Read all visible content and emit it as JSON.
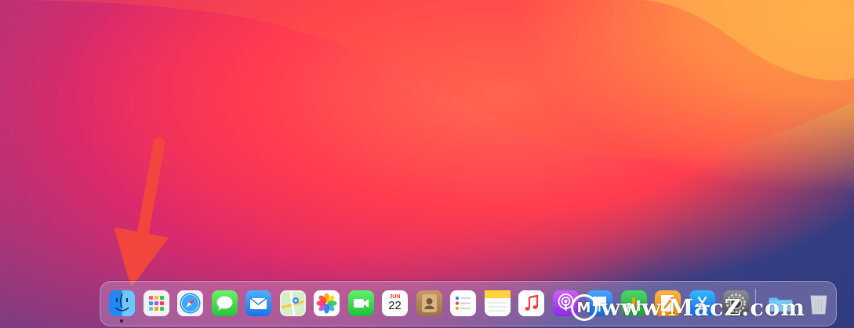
{
  "dock": {
    "apps": [
      {
        "name": "Finder",
        "icon": "finder-icon",
        "running": true
      },
      {
        "name": "Launchpad",
        "icon": "launchpad-icon"
      },
      {
        "name": "Safari",
        "icon": "safari-icon"
      },
      {
        "name": "Messages",
        "icon": "messages-icon"
      },
      {
        "name": "Mail",
        "icon": "mail-icon"
      },
      {
        "name": "Maps",
        "icon": "maps-icon"
      },
      {
        "name": "Photos",
        "icon": "photos-icon"
      },
      {
        "name": "FaceTime",
        "icon": "facetime-icon"
      },
      {
        "name": "Calendar",
        "icon": "calendar-icon"
      },
      {
        "name": "Contacts",
        "icon": "contacts-icon"
      },
      {
        "name": "Reminders",
        "icon": "reminders-icon"
      },
      {
        "name": "Notes",
        "icon": "notes-icon"
      },
      {
        "name": "Music",
        "icon": "music-icon"
      },
      {
        "name": "Podcasts",
        "icon": "podcasts-icon"
      },
      {
        "name": "Keynote",
        "icon": "keynote-icon"
      },
      {
        "name": "Numbers",
        "icon": "numbers-icon"
      },
      {
        "name": "Pages",
        "icon": "pages-icon"
      },
      {
        "name": "App Store",
        "icon": "app-store-icon"
      },
      {
        "name": "System Preferences",
        "icon": "system-preferences-icon"
      },
      {
        "name": "Downloads",
        "icon": "folder-icon"
      },
      {
        "name": "Trash",
        "icon": "trash-icon"
      }
    ],
    "calendar": {
      "month": "JUN",
      "day": "22"
    }
  },
  "watermark": {
    "text": "www.MacZ.com",
    "logo": "M"
  },
  "colors": {
    "arrow": "#f2453d",
    "dock_bg": "rgba(190,170,215,0.35)"
  }
}
